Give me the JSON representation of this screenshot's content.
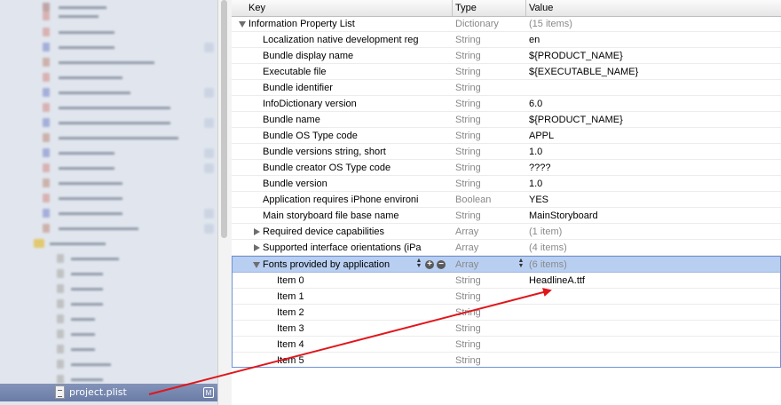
{
  "columns": {
    "key": "Key",
    "type": "Type",
    "value": "Value"
  },
  "navigator": {
    "selected_file": "project.plist",
    "selected_badge": "M"
  },
  "plist": {
    "root": {
      "key": "Information Property List",
      "type": "Dictionary",
      "value": "(15 items)"
    },
    "rows": [
      {
        "key": "Localization native development reg",
        "type": "String",
        "value": "en"
      },
      {
        "key": "Bundle display name",
        "type": "String",
        "value": "${PRODUCT_NAME}"
      },
      {
        "key": "Executable file",
        "type": "String",
        "value": "${EXECUTABLE_NAME}"
      },
      {
        "key": "Bundle identifier",
        "type": "String",
        "value": ""
      },
      {
        "key": "InfoDictionary version",
        "type": "String",
        "value": "6.0"
      },
      {
        "key": "Bundle name",
        "type": "String",
        "value": "${PRODUCT_NAME}"
      },
      {
        "key": "Bundle OS Type code",
        "type": "String",
        "value": "APPL"
      },
      {
        "key": "Bundle versions string, short",
        "type": "String",
        "value": "1.0"
      },
      {
        "key": "Bundle creator OS Type code",
        "type": "String",
        "value": "????"
      },
      {
        "key": "Bundle version",
        "type": "String",
        "value": "1.0"
      },
      {
        "key": "Application requires iPhone environi",
        "type": "Boolean",
        "value": "YES"
      },
      {
        "key": "Main storyboard file base name",
        "type": "String",
        "value": "MainStoryboard"
      }
    ],
    "collapsed": [
      {
        "key": "Required device capabilities",
        "type": "Array",
        "value": "(1 item)"
      },
      {
        "key": "Supported interface orientations (iPa",
        "type": "Array",
        "value": "(4 items)"
      }
    ],
    "fonts": {
      "key": "Fonts provided by application",
      "type": "Array",
      "value": "(6 items)",
      "items": [
        {
          "key": "Item 0",
          "type": "String",
          "value": "HeadlineA.ttf"
        },
        {
          "key": "Item 1",
          "type": "String",
          "value": ""
        },
        {
          "key": "Item 2",
          "type": "String",
          "value": ""
        },
        {
          "key": "Item 3",
          "type": "String",
          "value": ""
        },
        {
          "key": "Item 4",
          "type": "String",
          "value": ""
        },
        {
          "key": "Item 5",
          "type": "String",
          "value": ""
        }
      ]
    }
  },
  "colors": {
    "selection": "#b8cff2",
    "arrow": "#e0161b",
    "navigator_bg": "#e1e6ee"
  }
}
